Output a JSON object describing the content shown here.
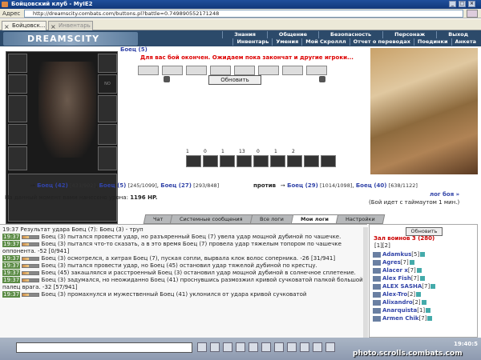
{
  "window": {
    "title": "Бойцовский клуб - MyIE2"
  },
  "address": {
    "label": "Адрес",
    "url": "http://dreamscity.combats.com/buttons.pl?battle=0.749890552171248"
  },
  "browser_tabs": [
    {
      "label": "Бойцовск..."
    },
    {
      "label": "Инвентарь"
    }
  ],
  "header": {
    "logo": "DREAMSCITY",
    "nav_top": [
      "Знания",
      "Общение",
      "Безопасность",
      "Персонаж",
      "Выход"
    ],
    "nav_bottom": [
      "Инвентарь",
      "Умения",
      "Мой Скроллл",
      "Отчет о переводах",
      "Поединки",
      "Анкета"
    ]
  },
  "battle": {
    "player_label": "Боец (5)",
    "wait_message": "Для вас бой окончен. Ожидаем пока закончат и другие игроки...",
    "refresh_label": "Обновить",
    "no_image": "NO IMAGE",
    "icon_counts": [
      "1",
      "0",
      "1",
      "13",
      "0",
      "1",
      "2"
    ],
    "team1": [
      {
        "name": "Боец (42)",
        "hp": "[433/902]"
      },
      {
        "name": "Боец (5)",
        "hp": "[245/1099]"
      },
      {
        "name": "Боец (27)",
        "hp": "[293/848]"
      }
    ],
    "versus": "против",
    "team2": [
      {
        "name": "Боец (29)",
        "hp": "[1014/1098]"
      },
      {
        "name": "Боец (40)",
        "hp": "[638/1122]"
      }
    ],
    "damage_prefix": "На данный момент вами нанесено урона:",
    "damage_value": "1196 HP.",
    "log_link": "лог боя »",
    "timeout_text": "(Бой идет с таймаутом 1 мин.)"
  },
  "chat": {
    "tabs": [
      "Чат",
      "Системные сообщения",
      "Все логи",
      "Мои логи",
      "Настройки"
    ],
    "active_tab": "Мои логи",
    "lines": [
      {
        "time": "19:37",
        "text": "Результат удара Боец (7): Боец (3) - труп"
      },
      {
        "time": "19:37",
        "text": "Боец (3) пытался провести удар, но разъяренный Боец (7) увела удар мощной дубиной по чашечке."
      },
      {
        "time": "19:37",
        "text": "Боец (3) пытался что-то сказать, а в это время Боец (7) провела удар тяжелым топором по чашечке оппонента. -52 [0/941]"
      },
      {
        "time": "19:37",
        "text": "Боец (3) осмотрелся, а хитрая Боец (7), пуская сопли, вырвала клок волос соперника. -26 [31/941]"
      },
      {
        "time": "19:37",
        "text": "Боец (3) пытался провести удар, но Боец (45) остановил удар тяжелой дубиной по крестцу."
      },
      {
        "time": "19:37",
        "text": "Боец (45) закашлялся и расстроенный Боец (3) остановил удар мощной дубиной в солнечное сплетение."
      },
      {
        "time": "19:37",
        "text": "Боец (3) задумался, но неожиданно Боец (41) проснувшись размозжил кривой сучковатой палкой большой палец врага. -32 [57/941]"
      },
      {
        "time": "19:37",
        "text": "Боец (3) промахнулся и мужественный Боец (41) уклонился от удара кривой сучковатой"
      }
    ]
  },
  "sidebar": {
    "refresh_label": "Обновить",
    "hall_title": "Зал воинов 3 (280)",
    "pages": "[1][2]",
    "players": [
      {
        "name": "Adamkus",
        "level": "[5]"
      },
      {
        "name": "Agres",
        "level": "[7]"
      },
      {
        "name": "Alacer x",
        "level": "[7]"
      },
      {
        "name": "Alex Fish",
        "level": "[7]"
      },
      {
        "name": "ALEX SASHA",
        "level": "[7]"
      },
      {
        "name": "Alex-Tro",
        "level": "[2]"
      },
      {
        "name": "Alixandro",
        "level": "[2]"
      },
      {
        "name": "Anarquista",
        "level": "[1]"
      },
      {
        "name": "Armen Chik",
        "level": "[7]"
      }
    ]
  },
  "status": {
    "clock": "19:40:5",
    "watermark": "photo.scrolls.combats.com"
  }
}
